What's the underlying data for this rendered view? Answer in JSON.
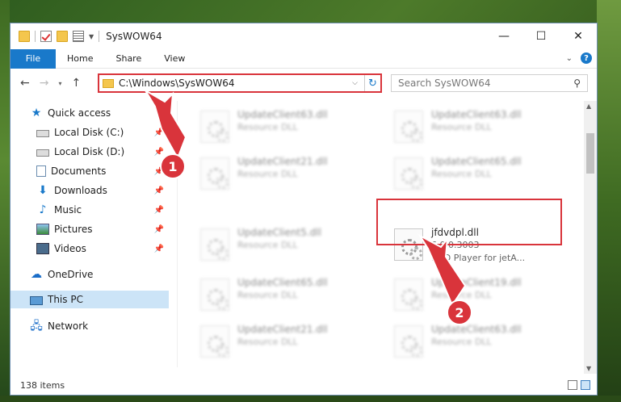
{
  "window": {
    "title": "SysWOW64",
    "minimize": "—",
    "maximize": "☐",
    "close": "✕"
  },
  "ribbon": {
    "tabs": [
      "File",
      "Home",
      "Share",
      "View"
    ],
    "expand_icon": "chevron-down-icon",
    "help": "?"
  },
  "address_bar": {
    "back": "←",
    "forward": "→",
    "recent": "▾",
    "up": "↑",
    "path": "C:\\Windows\\SysWOW64",
    "dropdown": "⌵",
    "refresh": "↻"
  },
  "search": {
    "placeholder": "Search SysWOW64",
    "icon": "⚲"
  },
  "sidebar": {
    "items": [
      {
        "label": "Quick access",
        "icon": "star-icon",
        "pinned": false
      },
      {
        "label": "Local Disk (C:)",
        "icon": "drive-icon",
        "pinned": true
      },
      {
        "label": "Local Disk (D:)",
        "icon": "drive-icon",
        "pinned": true
      },
      {
        "label": "Documents",
        "icon": "documents-icon",
        "pinned": true
      },
      {
        "label": "Downloads",
        "icon": "download-icon",
        "pinned": true
      },
      {
        "label": "Music",
        "icon": "music-icon",
        "pinned": true
      },
      {
        "label": "Pictures",
        "icon": "pictures-icon",
        "pinned": true
      },
      {
        "label": "Videos",
        "icon": "videos-icon",
        "pinned": true
      },
      {
        "label": "OneDrive",
        "icon": "onedrive-icon",
        "pinned": false
      },
      {
        "label": "This PC",
        "icon": "computer-icon",
        "pinned": false,
        "selected": true
      },
      {
        "label": "Network",
        "icon": "network-icon",
        "pinned": false
      }
    ]
  },
  "files": [
    {
      "name": "UpdateClient63.dll",
      "type": "Resource DLL",
      "blurred": true
    },
    {
      "name": "UpdateClient63.dll",
      "type": "Resource DLL",
      "blurred": true
    },
    {
      "name": "UpdateClient21.dll",
      "type": "Resource DLL",
      "blurred": true
    },
    {
      "name": "UpdateClient65.dll",
      "type": "Resource DLL",
      "blurred": true
    },
    {
      "name": "UpdateClient5.dll",
      "type": "Resource DLL",
      "blurred": true
    },
    {
      "name": "jfdvdpl.dll",
      "version": "6.0.0.3003",
      "type": "DVD Player for jetA...",
      "blurred": false
    },
    {
      "name": "UpdateClient65.dll",
      "type": "Resource DLL",
      "blurred": true
    },
    {
      "name": "UpdateClient19.dll",
      "type": "Resource DLL",
      "blurred": true
    },
    {
      "name": "UpdateClient21.dll",
      "type": "Resource DLL",
      "blurred": true
    },
    {
      "name": "UpdateClient63.dll",
      "type": "Resource DLL",
      "blurred": true
    }
  ],
  "status": {
    "item_count": "138 items"
  },
  "annotations": {
    "step1": "1",
    "step2": "2",
    "color": "#d9343b"
  }
}
